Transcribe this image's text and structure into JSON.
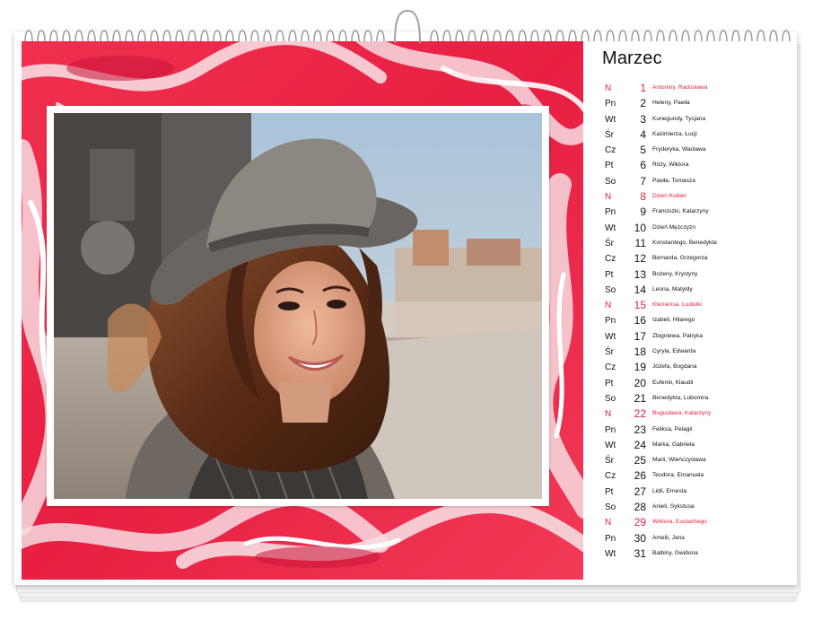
{
  "calendar": {
    "month": "Marzec",
    "accent_color": "#e3223f",
    "days": [
      {
        "wd": "N",
        "num": "1",
        "names": "Antoniny, Radosława",
        "sunday": true
      },
      {
        "wd": "Pn",
        "num": "2",
        "names": "Heleny, Pawła",
        "sunday": false
      },
      {
        "wd": "Wt",
        "num": "3",
        "names": "Kunegundy, Tycjana",
        "sunday": false
      },
      {
        "wd": "Śr",
        "num": "4",
        "names": "Kazimierza, Łucji",
        "sunday": false
      },
      {
        "wd": "Cz",
        "num": "5",
        "names": "Fryderyka, Wacława",
        "sunday": false
      },
      {
        "wd": "Pt",
        "num": "6",
        "names": "Róży, Wiktora",
        "sunday": false
      },
      {
        "wd": "So",
        "num": "7",
        "names": "Pawła, Tomasza",
        "sunday": false
      },
      {
        "wd": "N",
        "num": "8",
        "names": "Dzień Kobiet",
        "sunday": true
      },
      {
        "wd": "Pn",
        "num": "9",
        "names": "Franciszki, Katarzyny",
        "sunday": false
      },
      {
        "wd": "Wt",
        "num": "10",
        "names": "Dzień Mężczyzn",
        "sunday": false
      },
      {
        "wd": "Śr",
        "num": "11",
        "names": "Konstantego, Benedykta",
        "sunday": false
      },
      {
        "wd": "Cz",
        "num": "12",
        "names": "Bernarda, Grzegorza",
        "sunday": false
      },
      {
        "wd": "Pt",
        "num": "13",
        "names": "Bożeny, Krystyny",
        "sunday": false
      },
      {
        "wd": "So",
        "num": "14",
        "names": "Leona, Matyldy",
        "sunday": false
      },
      {
        "wd": "N",
        "num": "15",
        "names": "Klemensa, Ludwiki",
        "sunday": true
      },
      {
        "wd": "Pn",
        "num": "16",
        "names": "Izabeli, Hilarego",
        "sunday": false
      },
      {
        "wd": "Wt",
        "num": "17",
        "names": "Zbigniewa, Patryka",
        "sunday": false
      },
      {
        "wd": "Śr",
        "num": "18",
        "names": "Cyryla, Edwarda",
        "sunday": false
      },
      {
        "wd": "Cz",
        "num": "19",
        "names": "Józefa, Bogdana",
        "sunday": false
      },
      {
        "wd": "Pt",
        "num": "20",
        "names": "Eufemii, Klaudii",
        "sunday": false
      },
      {
        "wd": "So",
        "num": "21",
        "names": "Benedykta, Lubomira",
        "sunday": false
      },
      {
        "wd": "N",
        "num": "22",
        "names": "Bogusława, Katarzyny",
        "sunday": true
      },
      {
        "wd": "Pn",
        "num": "23",
        "names": "Feliksa, Pelagii",
        "sunday": false
      },
      {
        "wd": "Wt",
        "num": "24",
        "names": "Marka, Gabriela",
        "sunday": false
      },
      {
        "wd": "Śr",
        "num": "25",
        "names": "Marii, Wieńczysława",
        "sunday": false
      },
      {
        "wd": "Cz",
        "num": "26",
        "names": "Teodora, Emanuela",
        "sunday": false
      },
      {
        "wd": "Pt",
        "num": "27",
        "names": "Lidii, Ernesta",
        "sunday": false
      },
      {
        "wd": "So",
        "num": "28",
        "names": "Anieli, Sykstusa",
        "sunday": false
      },
      {
        "wd": "N",
        "num": "29",
        "names": "Wiktora, Eustachego",
        "sunday": true
      },
      {
        "wd": "Pn",
        "num": "30",
        "names": "Amelii, Jana",
        "sunday": false
      },
      {
        "wd": "Wt",
        "num": "31",
        "names": "Balbiny, Gwidona",
        "sunday": false
      }
    ]
  },
  "artwork": {
    "background_style": "red marble",
    "base_color": "#ec2a4b",
    "swirl_color": "#f6d9dd",
    "photo_subject": "smiling woman in grey hat"
  }
}
